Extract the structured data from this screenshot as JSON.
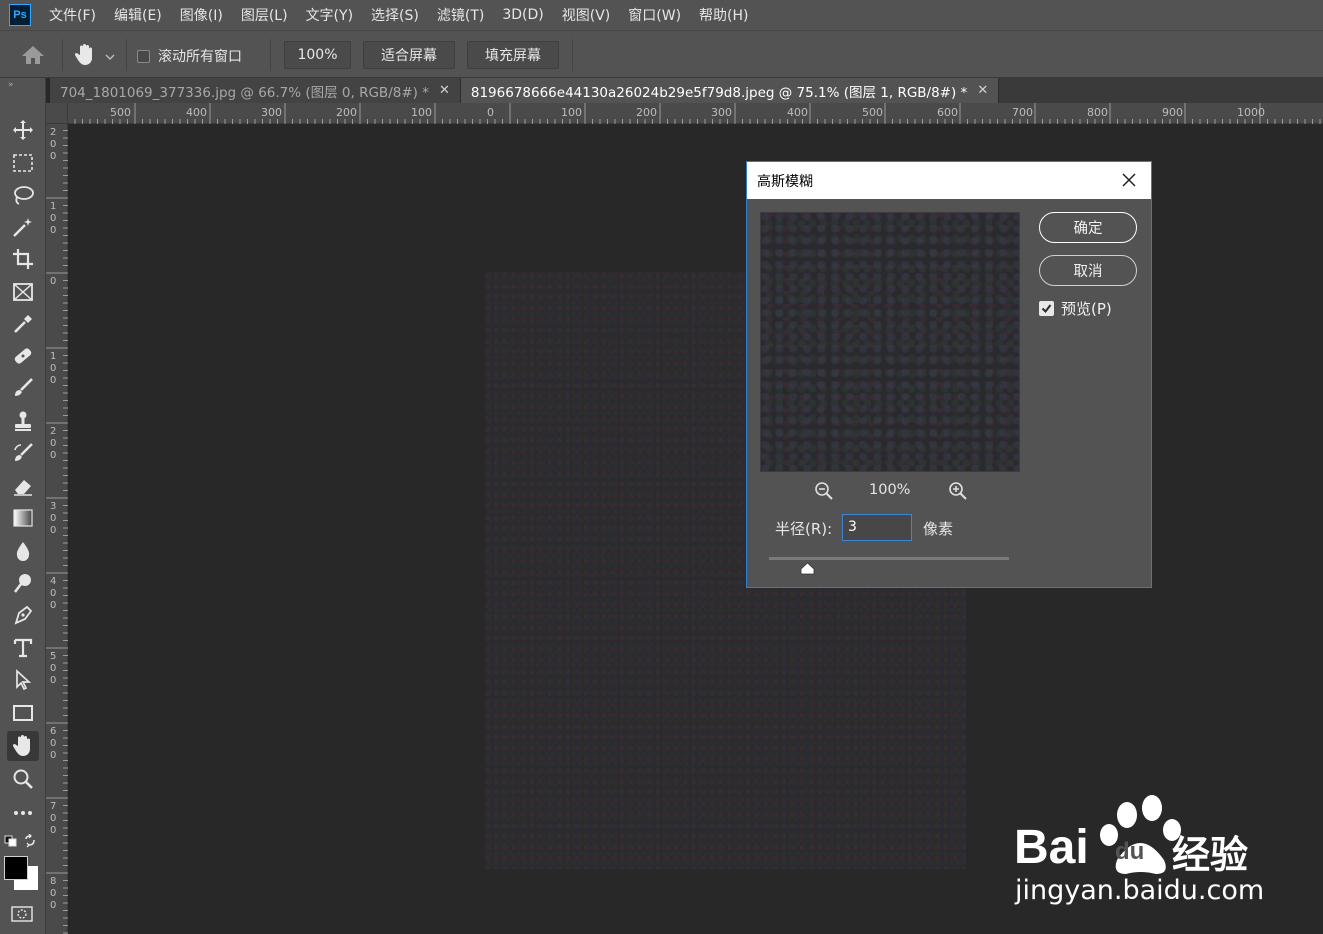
{
  "menubar": {
    "logo": "Ps",
    "items": [
      "文件(F)",
      "编辑(E)",
      "图像(I)",
      "图层(L)",
      "文字(Y)",
      "选择(S)",
      "滤镜(T)",
      "3D(D)",
      "视图(V)",
      "窗口(W)",
      "帮助(H)"
    ]
  },
  "options": {
    "scroll_all_label": "滚动所有窗口",
    "zoom_value": "100%",
    "fit_screen": "适合屏幕",
    "fill_screen": "填充屏幕"
  },
  "tabs": [
    {
      "label": "704_1801069_377336.jpg  @  66.7% (图层 0, RGB/8#) *",
      "close": "✕"
    },
    {
      "label": "8196678666e44130a26024b29e5f79d8.jpeg  @  75.1% (图层 1, RGB/8#) *",
      "close": "✕"
    }
  ],
  "ruler": {
    "h_labels": [
      "500",
      "400",
      "300",
      "200",
      "100",
      "0",
      "100",
      "200",
      "300",
      "400",
      "500",
      "600",
      "700",
      "800",
      "900",
      "1000"
    ],
    "v_labels": [
      "200",
      "100",
      "0",
      "100",
      "200",
      "300",
      "400",
      "500",
      "600",
      "700",
      "800"
    ]
  },
  "dialog": {
    "title": "高斯模糊",
    "ok": "确定",
    "cancel": "取消",
    "preview_label": "预览(P)",
    "preview_checked": true,
    "zoom": "100%",
    "radius_label": "半径(R):",
    "radius_value": "3",
    "radius_unit": "像素"
  },
  "watermark": {
    "brand": "Bai",
    "brand2": "du",
    "cn": "经验",
    "url": "jingyan.baidu.com"
  }
}
